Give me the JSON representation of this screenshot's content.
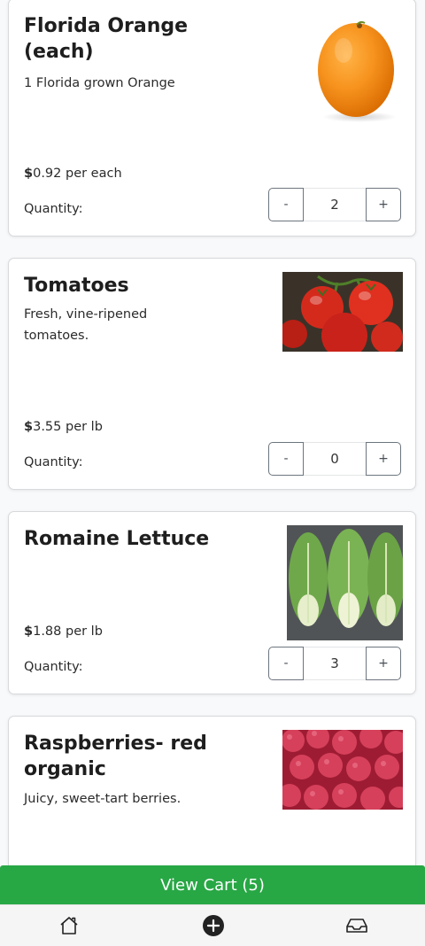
{
  "products": [
    {
      "name": "Florida Orange (each)",
      "description": "1 Florida grown Orange",
      "currency": "$",
      "price": "0.92 per each",
      "quantity_label": "Quantity:",
      "quantity": "2",
      "image": "orange-image"
    },
    {
      "name": "Tomatoes",
      "description": "Fresh, vine-ripened tomatoes.",
      "currency": "$",
      "price": "3.55 per lb",
      "quantity_label": "Quantity:",
      "quantity": "0",
      "image": "tomatoes-image"
    },
    {
      "name": "Romaine Lettuce",
      "description": "",
      "currency": "$",
      "price": "1.88 per lb",
      "quantity_label": "Quantity:",
      "quantity": "3",
      "image": "romaine-lettuce-image"
    },
    {
      "name": "Raspberries- red organic",
      "description": "Juicy, sweet-tart berries.",
      "image": "raspberries-image"
    }
  ],
  "stepper": {
    "minus": "-",
    "plus": "+"
  },
  "cart": {
    "label": "View Cart (5)",
    "color": "#28a745"
  },
  "nav": {
    "items": [
      "home-icon",
      "add-circle-icon",
      "inbox-icon"
    ]
  }
}
